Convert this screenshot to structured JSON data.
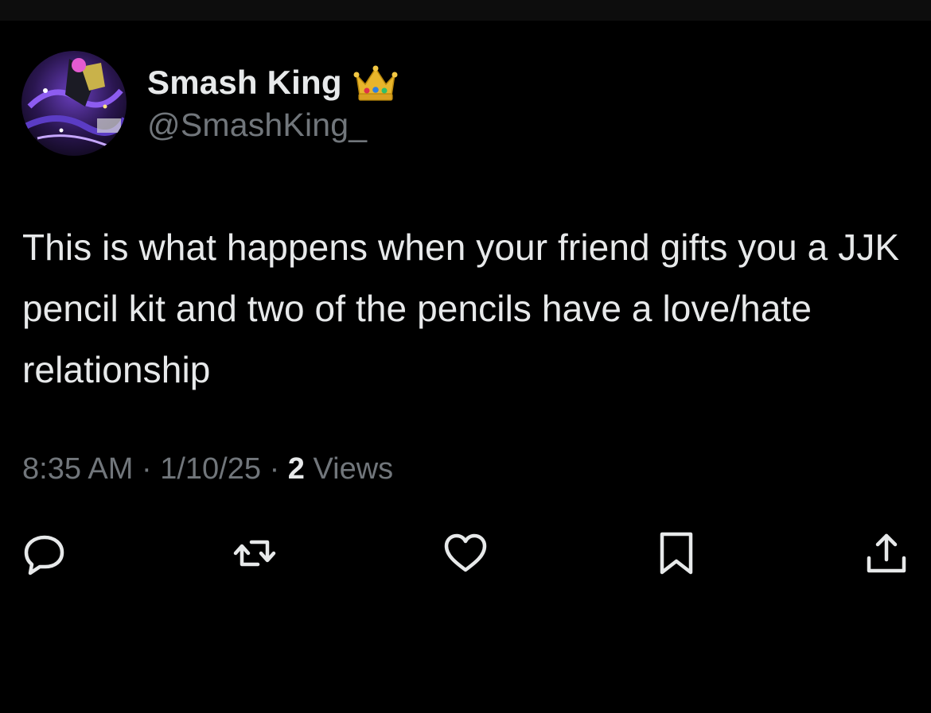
{
  "author": {
    "display_name": "Smash King",
    "badge_emoji": "crown",
    "handle": "@SmashKing_"
  },
  "tweet": {
    "text": "This is what happens when your friend gifts you a JJK pencil kit and two of the pencils have a love/hate relationship"
  },
  "meta": {
    "time": "8:35 AM",
    "separator": "·",
    "date": "1/10/25",
    "views_count": "2",
    "views_label": "Views"
  },
  "actions": [
    {
      "name": "reply",
      "icon": "reply-icon"
    },
    {
      "name": "retweet",
      "icon": "retweet-icon"
    },
    {
      "name": "like",
      "icon": "heart-icon"
    },
    {
      "name": "bookmark",
      "icon": "bookmark-icon"
    },
    {
      "name": "share",
      "icon": "share-icon"
    }
  ],
  "colors": {
    "background": "#000000",
    "primary_text": "#e7e9ea",
    "secondary_text": "#71767b"
  }
}
